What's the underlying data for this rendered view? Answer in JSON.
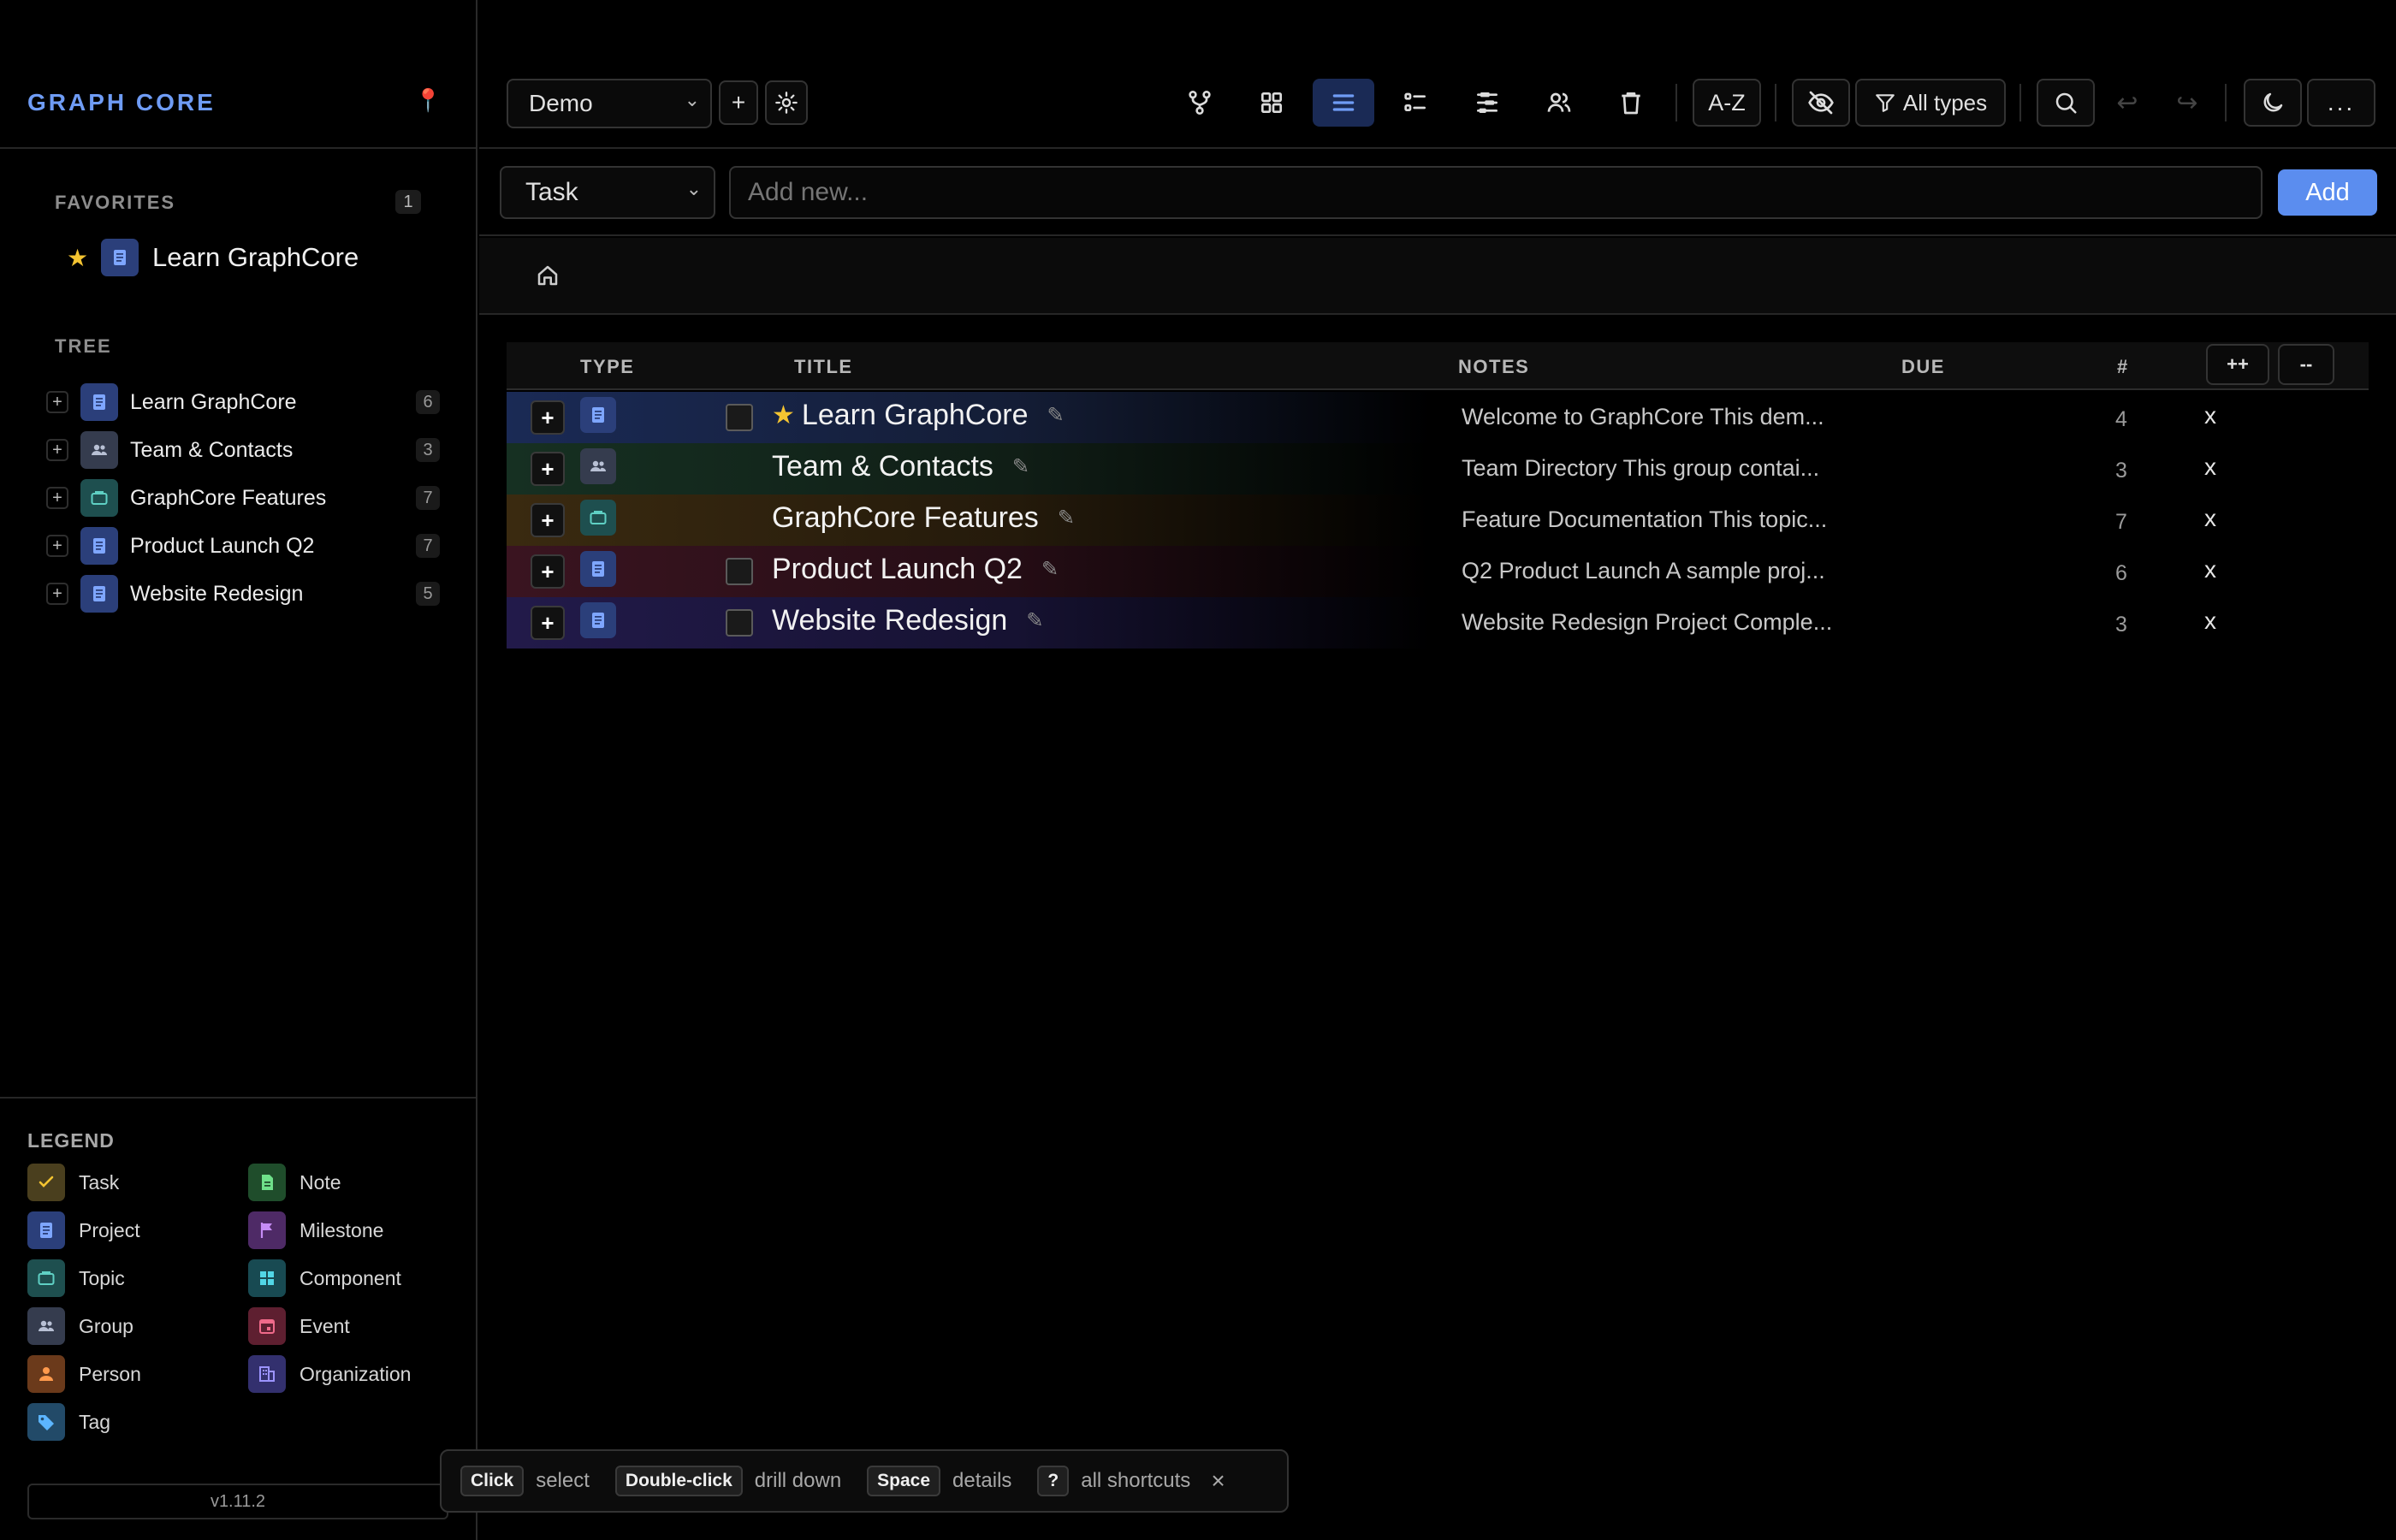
{
  "app": {
    "brand": "GRAPH CORE",
    "version": "v1.11.2"
  },
  "colors": {
    "accent": "#5b8def",
    "star": "#f4c431",
    "pin": "#e8474b"
  },
  "favorites": {
    "title": "FAVORITES",
    "count": "1",
    "items": [
      {
        "label": "Learn GraphCore",
        "icon": "project-icon"
      }
    ]
  },
  "tree": {
    "title": "TREE",
    "items": [
      {
        "label": "Learn GraphCore",
        "icon": "project-icon",
        "count": "6"
      },
      {
        "label": "Team & Contacts",
        "icon": "group-icon",
        "count": "3"
      },
      {
        "label": "GraphCore Features",
        "icon": "topic-icon",
        "count": "7"
      },
      {
        "label": "Product Launch Q2",
        "icon": "project-icon",
        "count": "7"
      },
      {
        "label": "Website Redesign",
        "icon": "project-icon",
        "count": "5"
      }
    ]
  },
  "legend": {
    "title": "LEGEND",
    "items": [
      {
        "label": "Task",
        "icon": "check-icon"
      },
      {
        "label": "Note",
        "icon": "note-icon"
      },
      {
        "label": "Project",
        "icon": "project-icon"
      },
      {
        "label": "Milestone",
        "icon": "flag-icon"
      },
      {
        "label": "Topic",
        "icon": "topic-icon"
      },
      {
        "label": "Component",
        "icon": "component-icon"
      },
      {
        "label": "Group",
        "icon": "group-icon"
      },
      {
        "label": "Event",
        "icon": "calendar-icon"
      },
      {
        "label": "Person",
        "icon": "person-icon"
      },
      {
        "label": "Organization",
        "icon": "organization-icon"
      },
      {
        "label": "Tag",
        "icon": "tag-icon"
      }
    ]
  },
  "toolbar": {
    "workspace": "Demo",
    "add_workspace": "+",
    "sort_label": "A-Z",
    "filter_label": "All types",
    "more_label": "...",
    "views": [
      "graph-view-icon",
      "grid-view-icon",
      "list-view-icon",
      "outline-view-icon",
      "timeline-view-icon",
      "people-view-icon",
      "trash-icon"
    ],
    "active_view": "list-view-icon"
  },
  "add_bar": {
    "type": "Task",
    "placeholder": "Add new...",
    "add_label": "Add"
  },
  "table": {
    "headers": {
      "type": "TYPE",
      "title": "TITLE",
      "notes": "NOTES",
      "due": "DUE",
      "count": "#"
    },
    "expand_all": "++",
    "collapse_all": "--",
    "rows": [
      {
        "title": "Learn GraphCore",
        "favorite": true,
        "icon": "project-icon",
        "checkbox": true,
        "notes": "Welcome to GraphCore This dem...",
        "due": "",
        "count": "4",
        "remove": "x"
      },
      {
        "title": "Team & Contacts",
        "favorite": false,
        "icon": "group-icon",
        "checkbox": false,
        "notes": "Team Directory This group contai...",
        "due": "",
        "count": "3",
        "remove": "x"
      },
      {
        "title": "GraphCore Features",
        "favorite": false,
        "icon": "topic-icon",
        "checkbox": false,
        "notes": "Feature Documentation This topic...",
        "due": "",
        "count": "7",
        "remove": "x"
      },
      {
        "title": "Product Launch Q2",
        "favorite": false,
        "icon": "project-icon",
        "checkbox": true,
        "notes": "Q2 Product Launch A sample proj...",
        "due": "",
        "count": "6",
        "remove": "x"
      },
      {
        "title": "Website Redesign",
        "favorite": false,
        "icon": "project-icon",
        "checkbox": true,
        "notes": "Website Redesign Project Comple...",
        "due": "",
        "count": "3",
        "remove": "x"
      }
    ]
  },
  "hints": {
    "items": [
      {
        "key": "Click",
        "text": "select"
      },
      {
        "key": "Double-click",
        "text": "drill down"
      },
      {
        "key": "Space",
        "text": "details"
      },
      {
        "key": "?",
        "text": "all shortcuts"
      }
    ],
    "close": "×"
  }
}
